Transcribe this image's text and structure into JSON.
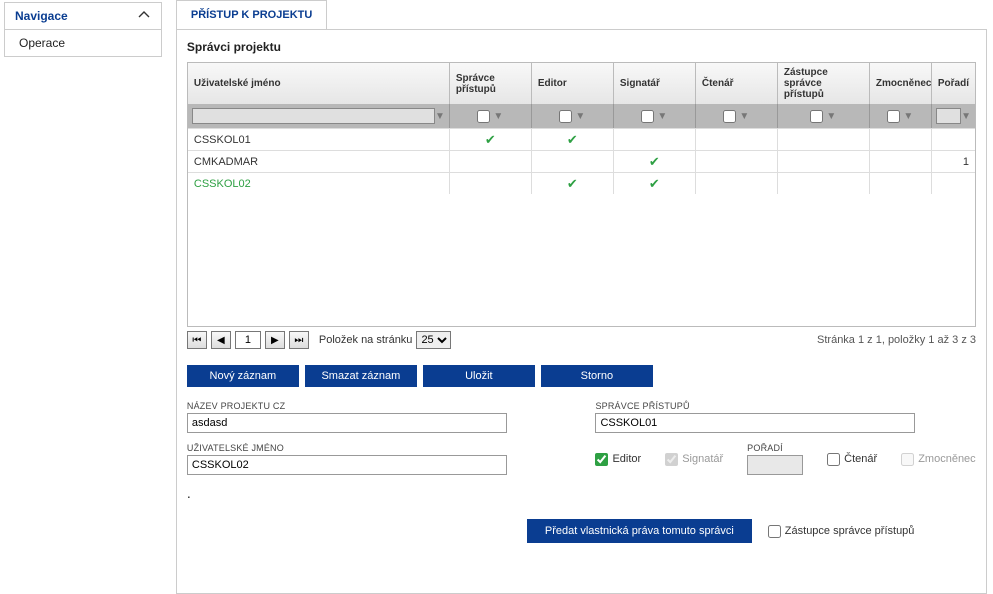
{
  "sidebar": {
    "nav_label": "Navigace",
    "items": [
      "Operace"
    ]
  },
  "tab": {
    "label": "PŘÍSTUP K PROJEKTU"
  },
  "section_title": "Správci projektu",
  "grid": {
    "cols": [
      "Uživatelské jméno",
      "Správce přístupů",
      "Editor",
      "Signatář",
      "Čtenář",
      "Zástupce správce přístupů",
      "Zmocněnec",
      "Pořadí"
    ],
    "rows": [
      {
        "user": "CSSKOL01",
        "spravce": true,
        "editor": true,
        "signatar": false,
        "ctenar": false,
        "zastupce": false,
        "zmocnenec": false,
        "poradi": ""
      },
      {
        "user": "CMKADMAR",
        "spravce": false,
        "editor": false,
        "signatar": true,
        "ctenar": false,
        "zastupce": false,
        "zmocnenec": false,
        "poradi": "1"
      },
      {
        "user": "CSSKOL02",
        "spravce": false,
        "editor": true,
        "signatar": true,
        "ctenar": false,
        "zastupce": false,
        "zmocnenec": false,
        "poradi": "",
        "hl": true
      }
    ]
  },
  "pager": {
    "page": "1",
    "per_page_label": "Položek na stránku",
    "per_page": "25",
    "info": "Stránka 1 z 1, položky 1 až 3 z 3"
  },
  "buttons": {
    "new": "Nový záznam",
    "delete": "Smazat záznam",
    "save": "Uložit",
    "cancel": "Storno",
    "transfer": "Předat vlastnická práva tomuto správci"
  },
  "form": {
    "project_name_label": "NÁZEV PROJEKTU CZ",
    "project_name": "asdasd",
    "access_mgr_label": "SPRÁVCE PŘÍSTUPŮ",
    "access_mgr": "CSSKOL01",
    "user_label": "UŽIVATELSKÉ JMÉNO",
    "user": "CSSKOL02",
    "editor_label": "Editor",
    "signatar_label": "Signatář",
    "poradi_label": "POŘADÍ",
    "ctenar_label": "Čtenář",
    "zmoc_label": "Zmocněnec",
    "zastupce_label": "Zástupce správce přístupů"
  }
}
